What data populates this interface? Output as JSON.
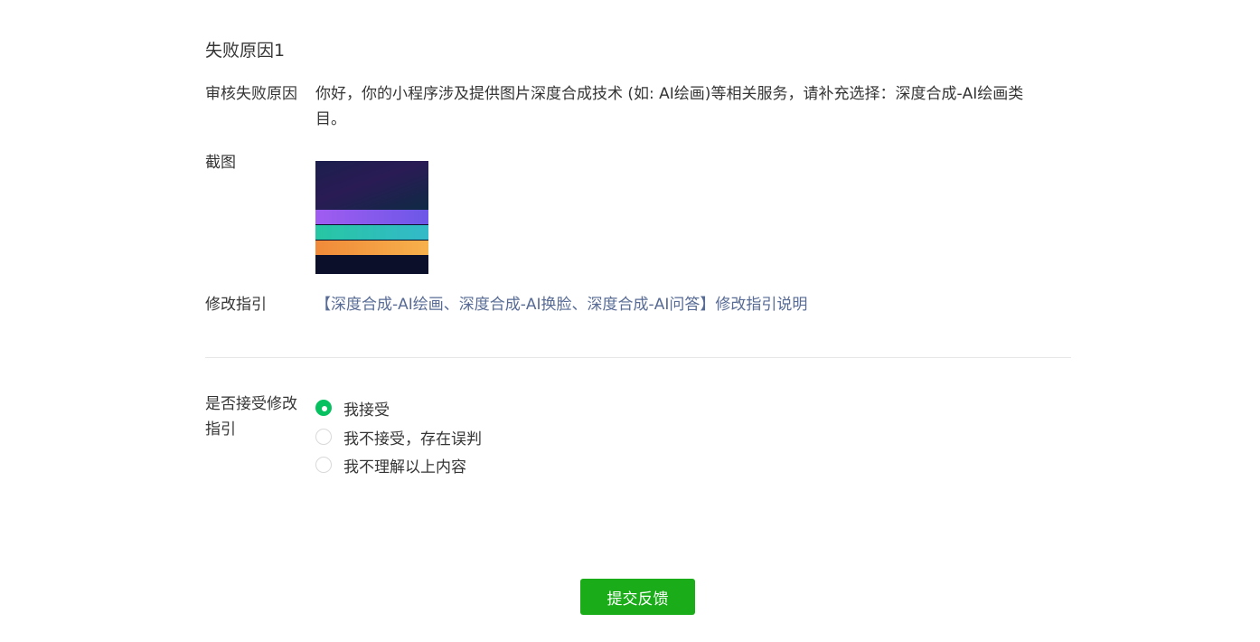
{
  "section": {
    "title": "失败原因1"
  },
  "rows": {
    "reason_label": "审核失败原因",
    "reason_text": "你好，你的小程序涉及提供图片深度合成技术 (如: AI绘画)等相关服务，请补充选择：深度合成-AI绘画类目。",
    "screenshot_label": "截图",
    "guide_label": "修改指引",
    "guide_link": "【深度合成-AI绘画、深度合成-AI换脸、深度合成-AI问答】修改指引说明"
  },
  "accept": {
    "label": "是否接受修改指引",
    "options": [
      {
        "label": "我接受",
        "selected": true
      },
      {
        "label": "我不接受，存在误判",
        "selected": false
      },
      {
        "label": "我不理解以上内容",
        "selected": false
      }
    ]
  },
  "submit": {
    "label": "提交反馈"
  },
  "colors": {
    "accent_green": "#07c160",
    "button_green": "#1aad19",
    "link_blue": "#576b95"
  }
}
